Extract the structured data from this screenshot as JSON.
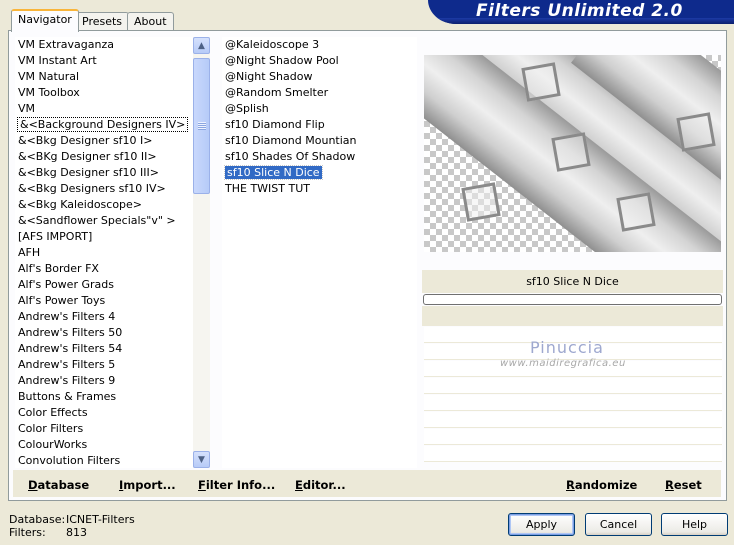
{
  "app_title": "Filters Unlimited 2.0",
  "tabs": [
    "Navigator",
    "Presets",
    "About"
  ],
  "categories": [
    "VM Extravaganza",
    "VM Instant Art",
    "VM Natural",
    "VM Toolbox",
    "VM",
    "&<Background Designers IV>",
    "&<Bkg Designer sf10 I>",
    "&<BKg Designer sf10 II>",
    "&<Bkg Designer sf10 III>",
    "&<Bkg Designers sf10 IV>",
    "&<Bkg Kaleidoscope>",
    "&<Sandflower Specials\"v\" >",
    "[AFS IMPORT]",
    "AFH",
    "Alf's Border FX",
    "Alf's Power Grads",
    "Alf's Power Toys",
    "Andrew's Filters 4",
    "Andrew's Filters 50",
    "Andrew's Filters 54",
    "Andrew's Filters 5",
    "Andrew's Filters 9",
    "Buttons & Frames",
    "Color Effects",
    "Color Filters",
    "ColourWorks",
    "Convolution Filters"
  ],
  "selected_category": "&<Background Designers IV>",
  "filters": [
    "@Kaleidoscope 3",
    "@Night Shadow Pool",
    "@Night Shadow",
    "@Random Smelter",
    "@Splish",
    "sf10 Diamond Flip",
    "sf10 Diamond Mountian",
    "sf10 Shades Of Shadow",
    "sf10 Slice N Dice",
    "THE TWIST TUT"
  ],
  "selected_filter": "sf10 Slice N Dice",
  "preview_title": "sf10 Slice N Dice",
  "watermark": {
    "name": "Pinuccia",
    "site": "www.maidiregrafica.eu"
  },
  "actions": {
    "database": "Database",
    "import": "Import...",
    "filter_info": "Filter Info...",
    "editor": "Editor...",
    "randomize": "Randomize",
    "reset": "Reset"
  },
  "status": {
    "database_label": "Database:",
    "database_value": "ICNET-Filters",
    "filters_label": "Filters:",
    "filters_value": "813"
  },
  "buttons": {
    "apply": "Apply",
    "cancel": "Cancel",
    "help": "Help"
  },
  "colors": {
    "banner": "#0E2A8C",
    "selection": "#316AC5",
    "dialog_bg": "#ECE9D8"
  }
}
